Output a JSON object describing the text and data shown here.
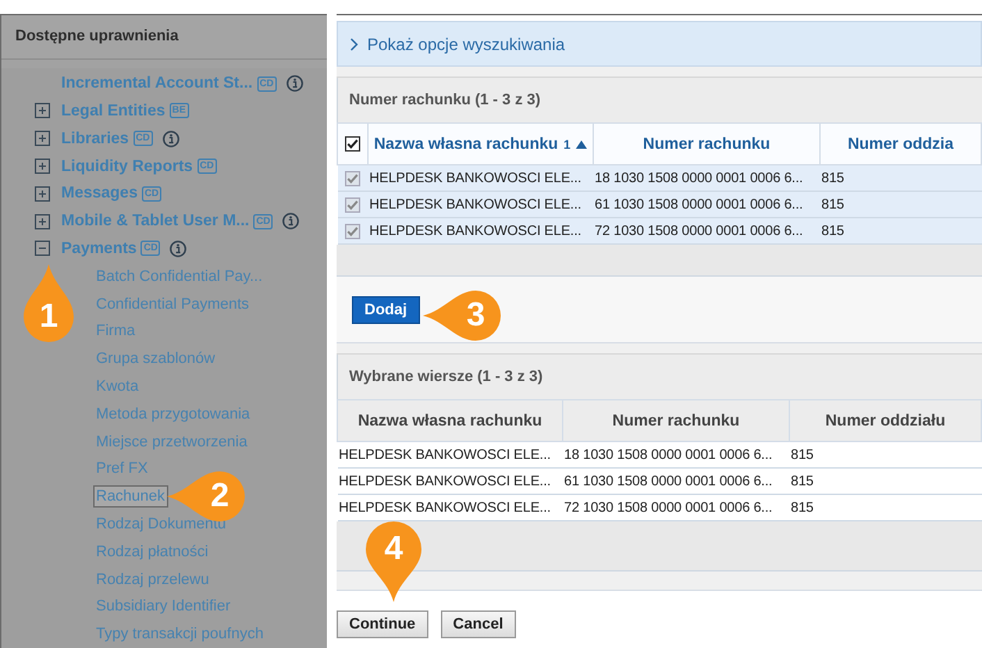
{
  "sidebar": {
    "title": "Dostępne uprawnienia",
    "items": [
      {
        "label": "Incremental Account St...",
        "expandable": false,
        "badge": "CD",
        "info": true
      },
      {
        "label": "Legal Entities",
        "expandable": true,
        "expanded": false,
        "badge": "BE",
        "info": false
      },
      {
        "label": "Libraries",
        "expandable": true,
        "expanded": false,
        "badge": "CD",
        "info": true
      },
      {
        "label": "Liquidity Reports",
        "expandable": true,
        "expanded": false,
        "badge": "CD",
        "info": false
      },
      {
        "label": "Messages",
        "expandable": true,
        "expanded": false,
        "badge": "CD",
        "info": false
      },
      {
        "label": "Mobile & Tablet User M...",
        "expandable": true,
        "expanded": false,
        "badge": "CD",
        "info": true
      },
      {
        "label": "Payments",
        "expandable": true,
        "expanded": true,
        "badge": "CD",
        "info": true,
        "children": [
          {
            "label": "Batch Confidential Pay...",
            "selected": false
          },
          {
            "label": "Confidential Payments",
            "selected": false
          },
          {
            "label": "Firma",
            "selected": false
          },
          {
            "label": "Grupa szablonów",
            "selected": false
          },
          {
            "label": "Kwota",
            "selected": false
          },
          {
            "label": "Metoda przygotowania",
            "selected": false
          },
          {
            "label": "Miejsce przetworzenia",
            "selected": false
          },
          {
            "label": "Pref FX",
            "selected": false
          },
          {
            "label": "Rachunek",
            "selected": true
          },
          {
            "label": "Rodzaj Dokumentu",
            "selected": false
          },
          {
            "label": "Rodzaj płatności",
            "selected": false
          },
          {
            "label": "Rodzaj przelewu",
            "selected": false
          },
          {
            "label": "Subsidiary Identifier",
            "selected": false
          },
          {
            "label": "Typy transakcji poufnych",
            "selected": false
          }
        ]
      }
    ]
  },
  "search_toggle": {
    "label": "Pokaż opcje wyszukiwania"
  },
  "available_table": {
    "title": "Numer rachunku (1 - 3 z 3)",
    "select_all_checked": true,
    "columns": [
      {
        "label": "Nazwa własna rachunku",
        "sort_order": "1"
      },
      {
        "label": "Numer rachunku"
      },
      {
        "label": "Numer oddzia"
      }
    ],
    "rows": [
      {
        "checked": true,
        "cells": [
          "HELPDESK BANKOWOSCI ELE...",
          "18 1030 1508 0000 0001 0006 6...",
          "815"
        ]
      },
      {
        "checked": true,
        "cells": [
          "HELPDESK BANKOWOSCI ELE...",
          "61 1030 1508 0000 0001 0006 6...",
          "815"
        ]
      },
      {
        "checked": true,
        "cells": [
          "HELPDESK BANKOWOSCI ELE...",
          "72 1030 1508 0000 0001 0006 6...",
          "815"
        ]
      }
    ]
  },
  "add_button": "Dodaj",
  "selected_table": {
    "title": "Wybrane wiersze (1 - 3 z 3)",
    "columns": [
      "Nazwa własna rachunku",
      "Numer rachunku",
      "Numer oddziału"
    ],
    "rows": [
      [
        "HELPDESK BANKOWOSCI ELE...",
        "18 1030 1508 0000 0001 0006 6...",
        "815"
      ],
      [
        "HELPDESK BANKOWOSCI ELE...",
        "61 1030 1508 0000 0001 0006 6...",
        "815"
      ],
      [
        "HELPDESK BANKOWOSCI ELE...",
        "72 1030 1508 0000 0001 0006 6...",
        "815"
      ]
    ]
  },
  "buttons": [
    "Continue",
    "Cancel"
  ],
  "callouts": [
    {
      "label": "1",
      "kind": "up"
    },
    {
      "label": "2",
      "kind": "left"
    },
    {
      "label": "3",
      "kind": "left"
    },
    {
      "label": "4",
      "kind": "down"
    }
  ]
}
